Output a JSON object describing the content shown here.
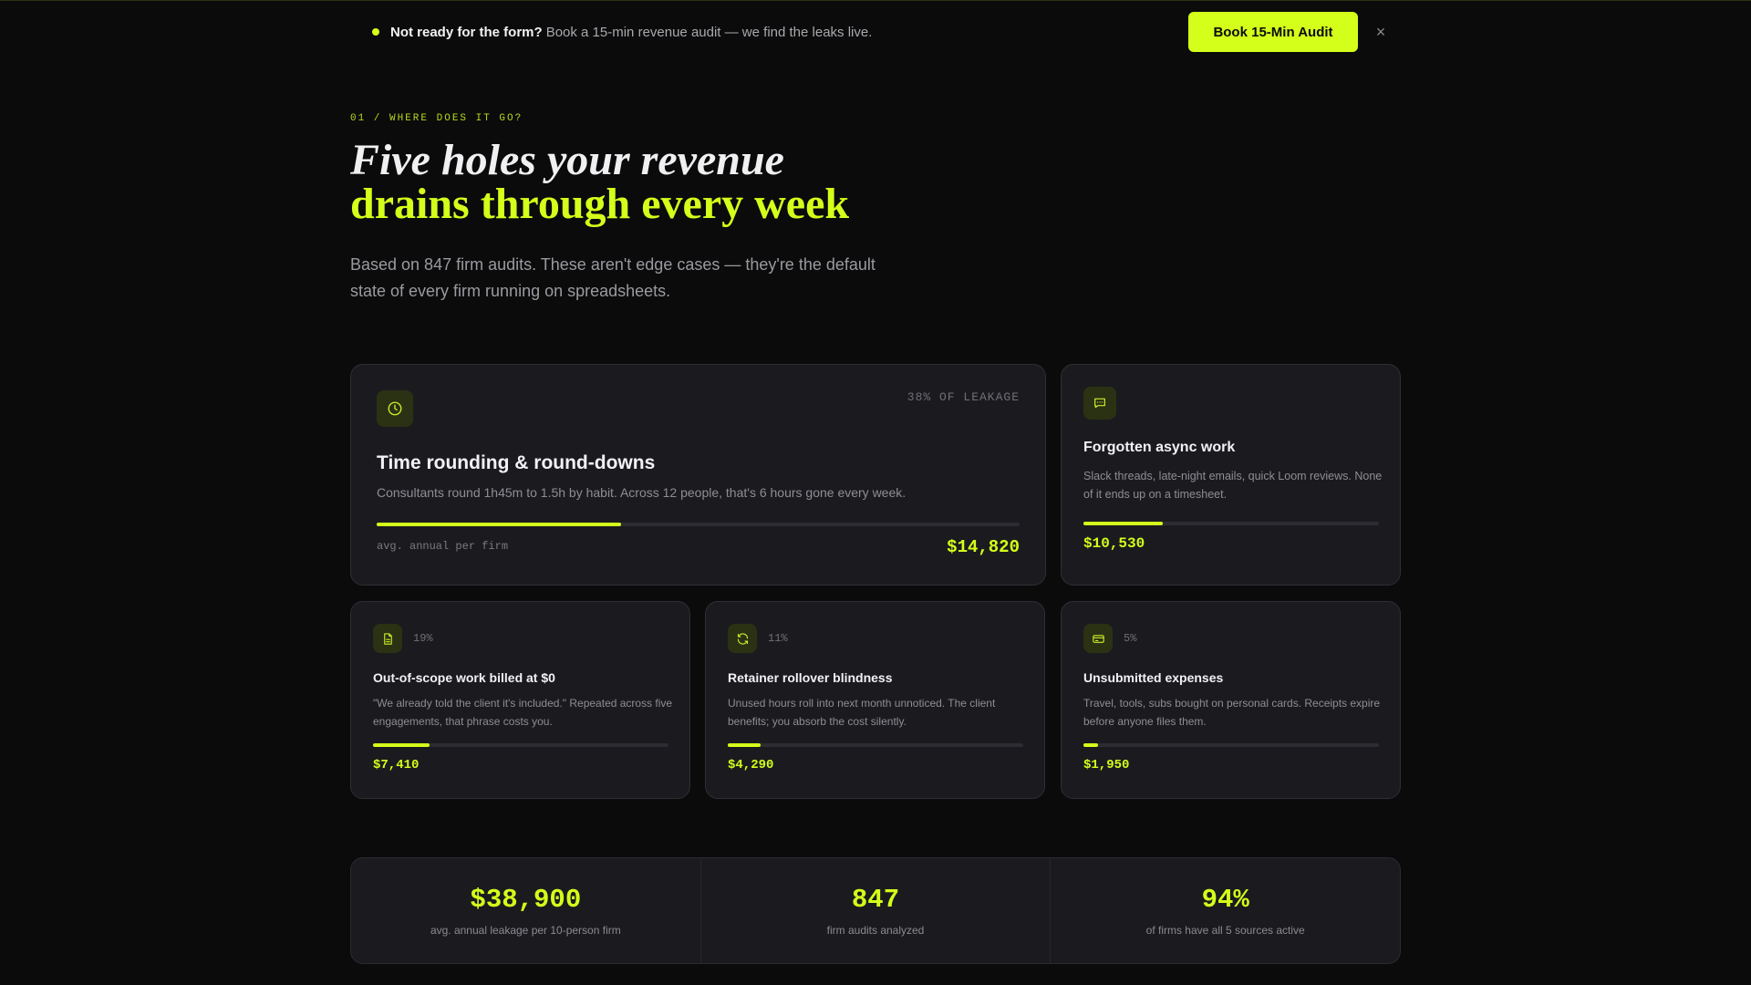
{
  "announce": {
    "bold": "Not ready for the form?",
    "text": "Book a 15-min revenue audit — we find the leaks live.",
    "cta": "Book 15-Min Audit",
    "close": "×"
  },
  "hero": {
    "eyebrow": "01 / WHERE DOES IT GO?",
    "headline_line1": "Five holes your revenue",
    "headline_line2": "drains through every week",
    "subhead": "Based on 847 firm audits. These aren't edge cases — they're the default state of every firm running on spreadsheets."
  },
  "cards": [
    {
      "icon": "clock-icon",
      "share": "38% OF LEAKAGE",
      "share_value": 0.38,
      "title": "Time rounding & round-downs",
      "description": "Consultants round 1h45m to 1.5h by habit. Across 12 people, that's 6 hours gone every week.",
      "footer_label": "avg. annual per firm",
      "amount": "$14,820"
    },
    {
      "icon": "message-icon",
      "share_value": 0.27,
      "title": "Forgotten async work",
      "description": "Slack threads, late-night emails, quick Loom reviews. None of it ends up on a timesheet.",
      "amount": "$10,530"
    },
    {
      "icon": "document-icon",
      "share": "19%",
      "share_value": 0.19,
      "title": "Out-of-scope work billed at $0",
      "description": "\"We already told the client it's included.\" Repeated across five engagements, that phrase costs you.",
      "amount": "$7,410"
    },
    {
      "icon": "refresh-icon",
      "share": "11%",
      "share_value": 0.11,
      "title": "Retainer rollover blindness",
      "description": "Unused hours roll into next month unnoticed. The client benefits; you absorb the cost silently.",
      "amount": "$4,290"
    },
    {
      "icon": "credit-card-icon",
      "share": "5%",
      "share_value": 0.05,
      "title": "Unsubmitted expenses",
      "description": "Travel, tools, subs bought on personal cards. Receipts expire before anyone files them.",
      "amount": "$1,950"
    }
  ],
  "stats": [
    {
      "value": "$38,900",
      "label": "avg. annual leakage per 10-person firm"
    },
    {
      "value": "847",
      "label": "firm audits analyzed"
    },
    {
      "value": "94%",
      "label": "of firms have all 5 sources active"
    }
  ],
  "colors": {
    "accent": "#d4ff1a",
    "background": "#0b0b0c",
    "card": "#1b1b1f"
  }
}
